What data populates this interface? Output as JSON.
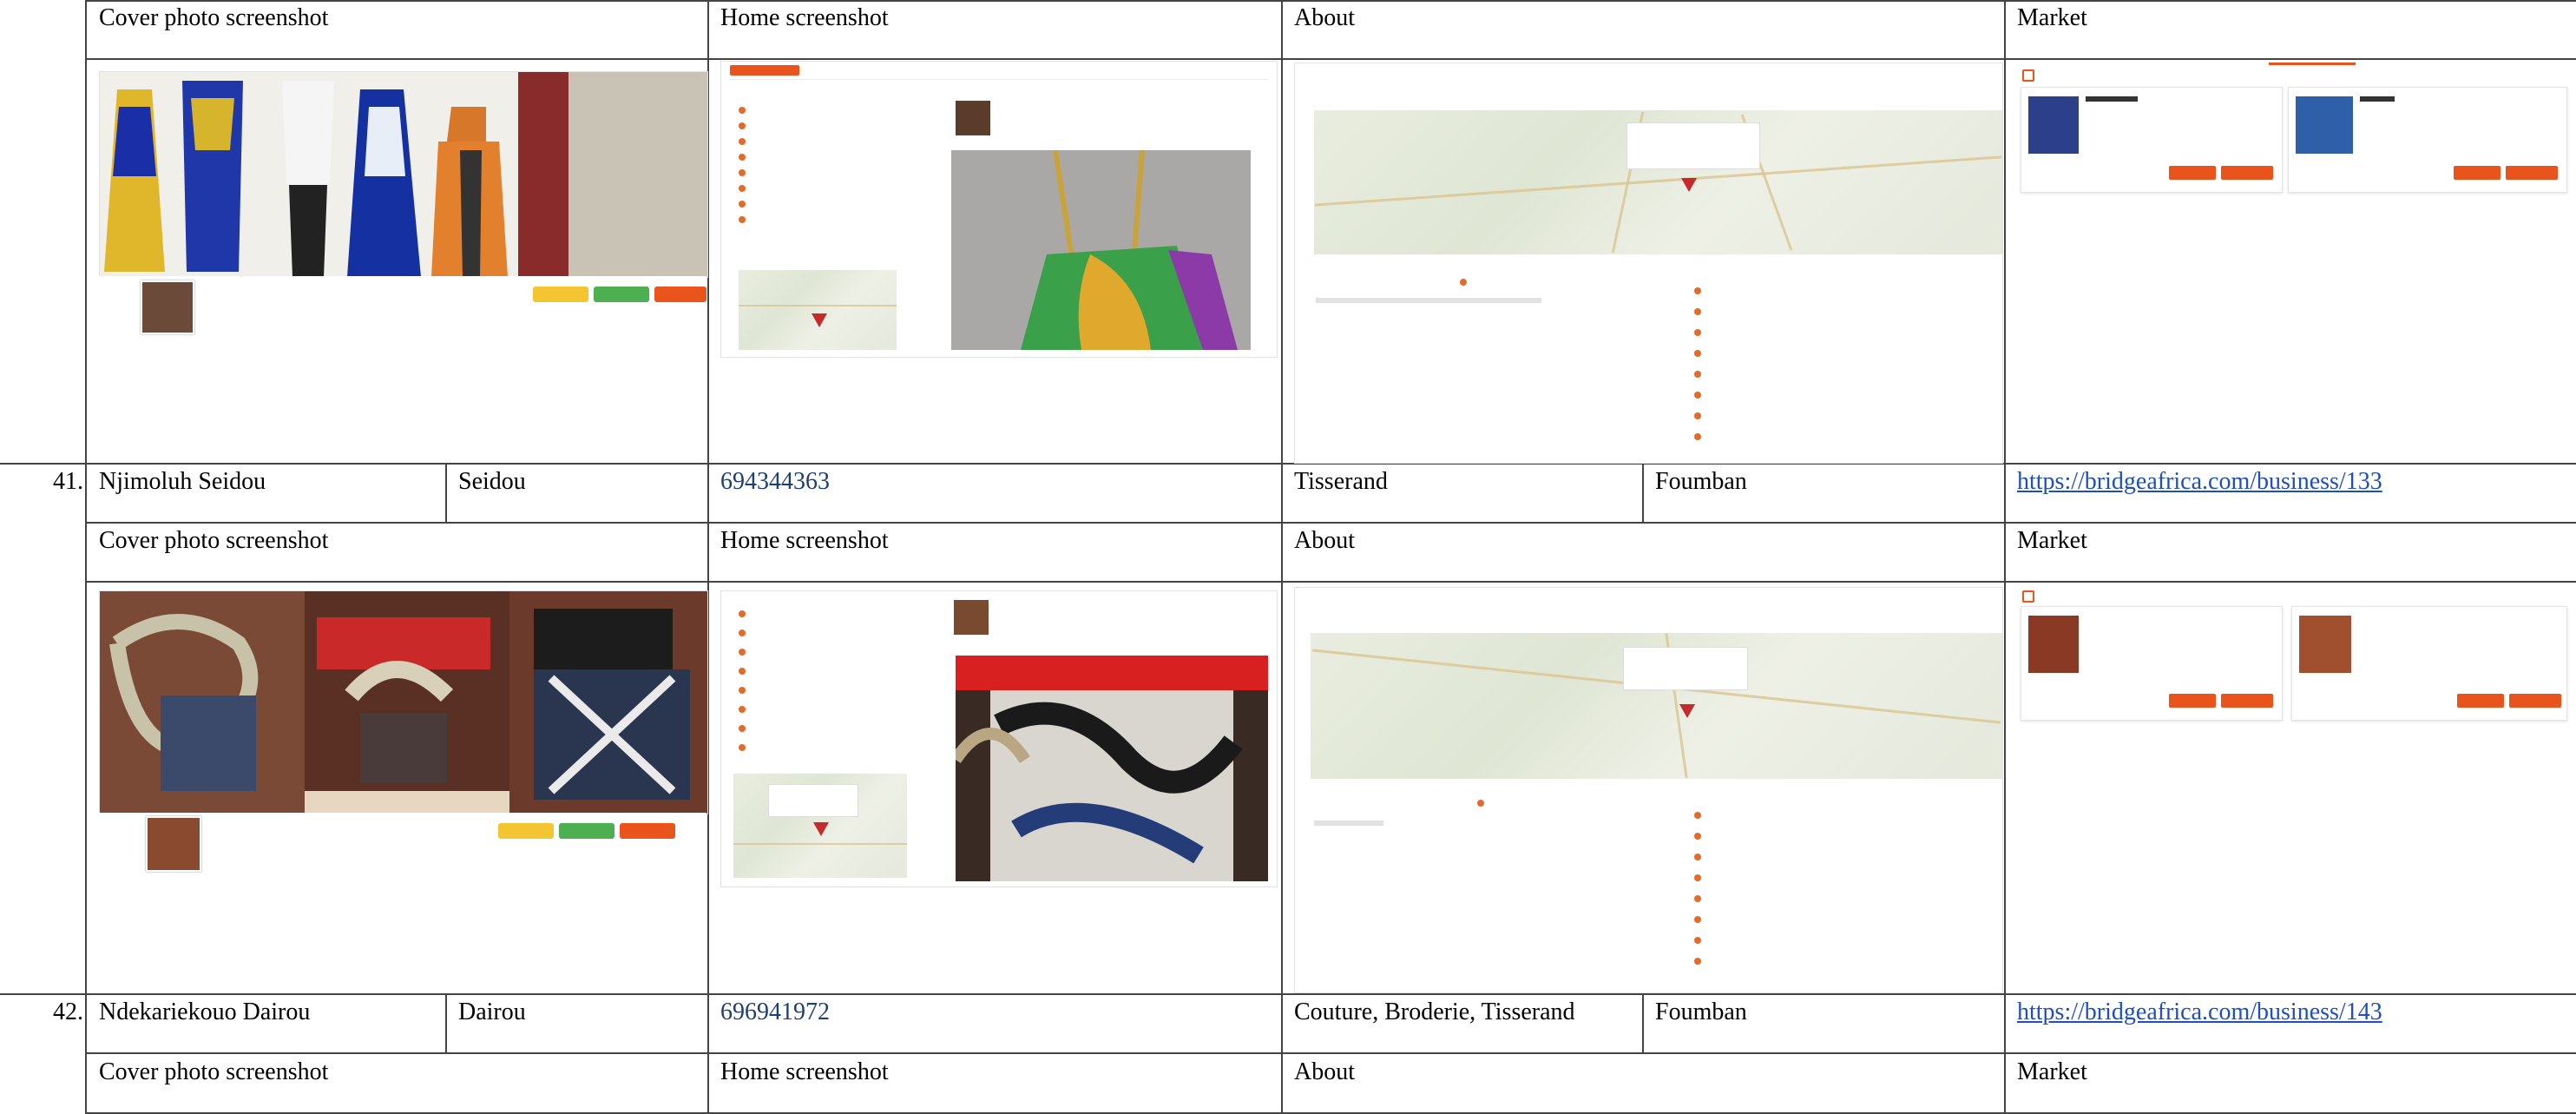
{
  "top_header": {
    "cover": "Cover photo screenshot",
    "home": "Home screenshot",
    "about": "About",
    "market": "Market"
  },
  "rows": [
    {
      "number": "41.",
      "full_name": "Njimoluh Seidou",
      "short_name": "Seidou",
      "phone": "694344363",
      "trade": "Tisserand",
      "city": "Foumban",
      "url": "https://bridgeafrica.com/business/133",
      "headers": {
        "cover": "Cover photo screenshot",
        "home": "Home screenshot",
        "about": "About",
        "market": "Market"
      }
    },
    {
      "number": "42.",
      "full_name": "Ndekariekouo Dairou",
      "short_name": "Dairou",
      "phone": "696941972",
      "trade": "Couture, Broderie, Tisserand",
      "city": "Foumban",
      "url": "https://bridgeafrica.com/business/143",
      "headers": {
        "cover": "Cover photo screenshot",
        "home": "Home screenshot",
        "about": "About",
        "market": "Market"
      }
    }
  ],
  "colors": {
    "grid": "#444444",
    "link": "#1f4fbf",
    "brand_orange": "#e8541c",
    "map_pin": "#c62a2a"
  }
}
